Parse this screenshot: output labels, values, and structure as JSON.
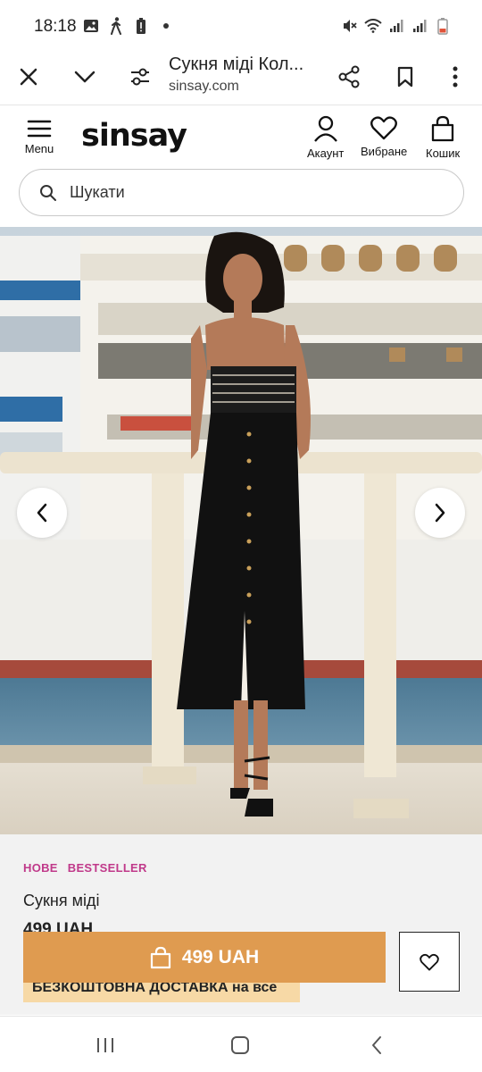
{
  "status_bar": {
    "time": "18:18",
    "left_icons": [
      "image-icon",
      "walking-icon",
      "battery-alert-icon",
      "dot-icon"
    ],
    "right_icons": [
      "mute-icon",
      "wifi-icon",
      "signal-icon",
      "signal-icon",
      "battery-icon"
    ]
  },
  "browser": {
    "page_title": "Сукня міді Кол...",
    "host": "sinsay.com"
  },
  "site": {
    "logo": "sinsay",
    "menu_label": "Menu",
    "account_label": "Акаунт",
    "wishlist_label": "Вибране",
    "cart_label": "Кошик"
  },
  "search": {
    "placeholder": "Шукати"
  },
  "product": {
    "tags": [
      "НОВЕ",
      "BESTSELLER"
    ],
    "name": "Сукня міді",
    "price_partial": "499 UAH",
    "cart_button_label": "499 UAH",
    "promo_text": "БЕЗКОШТОВНА ДОСТАВКА на все"
  },
  "colors": {
    "accent": "#df9b50",
    "tag": "#c0398a",
    "promo_bg": "#f7d9a6",
    "info_bg": "#f2f2f2"
  }
}
